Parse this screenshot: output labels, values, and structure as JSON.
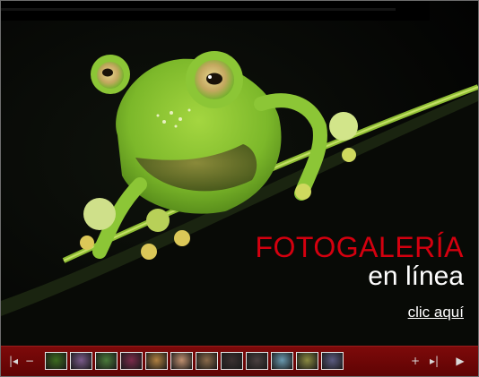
{
  "caption": {
    "line1": "FOTOGALERÍA",
    "line2": "en línea",
    "link": "clic aquí"
  },
  "nav": {
    "first_icon": "skip-to-first-icon",
    "zoom_out_icon": "minus-icon",
    "zoom_in_icon": "plus-icon",
    "last_icon": "skip-to-last-icon",
    "play_icon": "play-icon",
    "zoom_out_label": "−",
    "zoom_in_label": "+",
    "first_label": "|◂",
    "last_label": "▸|",
    "play_label": "▶"
  },
  "thumbnails": [
    {
      "subject": "frog",
      "color": "#3d6b1e"
    },
    {
      "subject": "purple texture",
      "color": "#7a5a8a"
    },
    {
      "subject": "succulent",
      "color": "#4a7a3a"
    },
    {
      "subject": "pink flower",
      "color": "#7a2a4a"
    },
    {
      "subject": "golden shell",
      "color": "#b08040"
    },
    {
      "subject": "sky",
      "color": "#c09070"
    },
    {
      "subject": "owl",
      "color": "#8a6a4a"
    },
    {
      "subject": "dark scene",
      "color": "#3a3030"
    },
    {
      "subject": "dark scene 2",
      "color": "#4a4040"
    },
    {
      "subject": "ice",
      "color": "#6a9ab0"
    },
    {
      "subject": "insect",
      "color": "#8a8a40"
    },
    {
      "subject": "children",
      "color": "#5a5a80"
    }
  ],
  "colors": {
    "accent_red": "#d4000f",
    "bar_red": "#6e0606"
  }
}
